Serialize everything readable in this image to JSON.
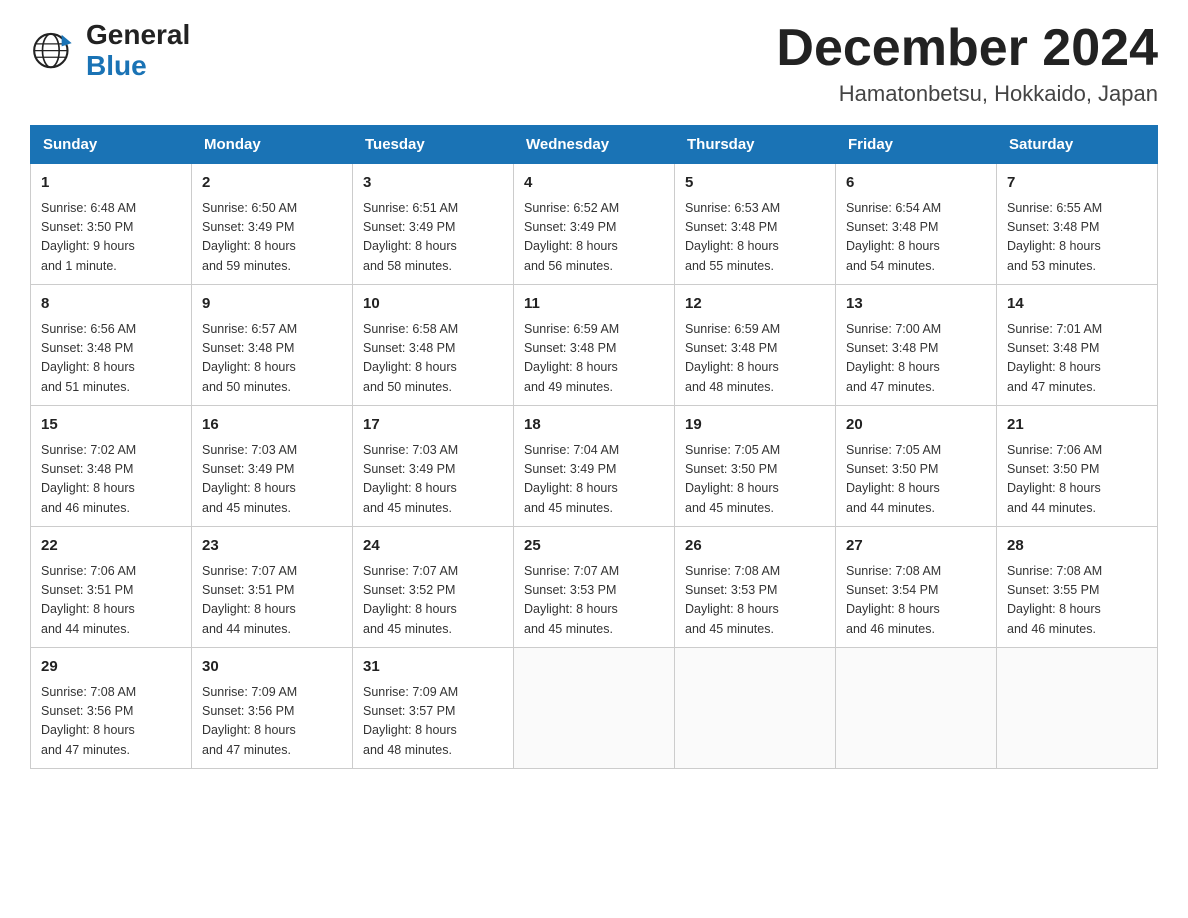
{
  "header": {
    "title": "December 2024",
    "subtitle": "Hamatonbetsu, Hokkaido, Japan",
    "logo_general": "General",
    "logo_blue": "Blue"
  },
  "calendar": {
    "days_of_week": [
      "Sunday",
      "Monday",
      "Tuesday",
      "Wednesday",
      "Thursday",
      "Friday",
      "Saturday"
    ],
    "weeks": [
      [
        {
          "num": "1",
          "info": "Sunrise: 6:48 AM\nSunset: 3:50 PM\nDaylight: 9 hours\nand 1 minute."
        },
        {
          "num": "2",
          "info": "Sunrise: 6:50 AM\nSunset: 3:49 PM\nDaylight: 8 hours\nand 59 minutes."
        },
        {
          "num": "3",
          "info": "Sunrise: 6:51 AM\nSunset: 3:49 PM\nDaylight: 8 hours\nand 58 minutes."
        },
        {
          "num": "4",
          "info": "Sunrise: 6:52 AM\nSunset: 3:49 PM\nDaylight: 8 hours\nand 56 minutes."
        },
        {
          "num": "5",
          "info": "Sunrise: 6:53 AM\nSunset: 3:48 PM\nDaylight: 8 hours\nand 55 minutes."
        },
        {
          "num": "6",
          "info": "Sunrise: 6:54 AM\nSunset: 3:48 PM\nDaylight: 8 hours\nand 54 minutes."
        },
        {
          "num": "7",
          "info": "Sunrise: 6:55 AM\nSunset: 3:48 PM\nDaylight: 8 hours\nand 53 minutes."
        }
      ],
      [
        {
          "num": "8",
          "info": "Sunrise: 6:56 AM\nSunset: 3:48 PM\nDaylight: 8 hours\nand 51 minutes."
        },
        {
          "num": "9",
          "info": "Sunrise: 6:57 AM\nSunset: 3:48 PM\nDaylight: 8 hours\nand 50 minutes."
        },
        {
          "num": "10",
          "info": "Sunrise: 6:58 AM\nSunset: 3:48 PM\nDaylight: 8 hours\nand 50 minutes."
        },
        {
          "num": "11",
          "info": "Sunrise: 6:59 AM\nSunset: 3:48 PM\nDaylight: 8 hours\nand 49 minutes."
        },
        {
          "num": "12",
          "info": "Sunrise: 6:59 AM\nSunset: 3:48 PM\nDaylight: 8 hours\nand 48 minutes."
        },
        {
          "num": "13",
          "info": "Sunrise: 7:00 AM\nSunset: 3:48 PM\nDaylight: 8 hours\nand 47 minutes."
        },
        {
          "num": "14",
          "info": "Sunrise: 7:01 AM\nSunset: 3:48 PM\nDaylight: 8 hours\nand 47 minutes."
        }
      ],
      [
        {
          "num": "15",
          "info": "Sunrise: 7:02 AM\nSunset: 3:48 PM\nDaylight: 8 hours\nand 46 minutes."
        },
        {
          "num": "16",
          "info": "Sunrise: 7:03 AM\nSunset: 3:49 PM\nDaylight: 8 hours\nand 45 minutes."
        },
        {
          "num": "17",
          "info": "Sunrise: 7:03 AM\nSunset: 3:49 PM\nDaylight: 8 hours\nand 45 minutes."
        },
        {
          "num": "18",
          "info": "Sunrise: 7:04 AM\nSunset: 3:49 PM\nDaylight: 8 hours\nand 45 minutes."
        },
        {
          "num": "19",
          "info": "Sunrise: 7:05 AM\nSunset: 3:50 PM\nDaylight: 8 hours\nand 45 minutes."
        },
        {
          "num": "20",
          "info": "Sunrise: 7:05 AM\nSunset: 3:50 PM\nDaylight: 8 hours\nand 44 minutes."
        },
        {
          "num": "21",
          "info": "Sunrise: 7:06 AM\nSunset: 3:50 PM\nDaylight: 8 hours\nand 44 minutes."
        }
      ],
      [
        {
          "num": "22",
          "info": "Sunrise: 7:06 AM\nSunset: 3:51 PM\nDaylight: 8 hours\nand 44 minutes."
        },
        {
          "num": "23",
          "info": "Sunrise: 7:07 AM\nSunset: 3:51 PM\nDaylight: 8 hours\nand 44 minutes."
        },
        {
          "num": "24",
          "info": "Sunrise: 7:07 AM\nSunset: 3:52 PM\nDaylight: 8 hours\nand 45 minutes."
        },
        {
          "num": "25",
          "info": "Sunrise: 7:07 AM\nSunset: 3:53 PM\nDaylight: 8 hours\nand 45 minutes."
        },
        {
          "num": "26",
          "info": "Sunrise: 7:08 AM\nSunset: 3:53 PM\nDaylight: 8 hours\nand 45 minutes."
        },
        {
          "num": "27",
          "info": "Sunrise: 7:08 AM\nSunset: 3:54 PM\nDaylight: 8 hours\nand 46 minutes."
        },
        {
          "num": "28",
          "info": "Sunrise: 7:08 AM\nSunset: 3:55 PM\nDaylight: 8 hours\nand 46 minutes."
        }
      ],
      [
        {
          "num": "29",
          "info": "Sunrise: 7:08 AM\nSunset: 3:56 PM\nDaylight: 8 hours\nand 47 minutes."
        },
        {
          "num": "30",
          "info": "Sunrise: 7:09 AM\nSunset: 3:56 PM\nDaylight: 8 hours\nand 47 minutes."
        },
        {
          "num": "31",
          "info": "Sunrise: 7:09 AM\nSunset: 3:57 PM\nDaylight: 8 hours\nand 48 minutes."
        },
        {
          "num": "",
          "info": ""
        },
        {
          "num": "",
          "info": ""
        },
        {
          "num": "",
          "info": ""
        },
        {
          "num": "",
          "info": ""
        }
      ]
    ]
  }
}
